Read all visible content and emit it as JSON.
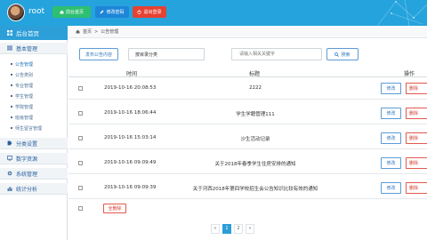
{
  "header": {
    "username": "root",
    "buttons": {
      "home": "前台首页",
      "change_password": "修改密码",
      "logout": "退出登录"
    }
  },
  "sidebar": {
    "home": "后台首页",
    "groups": [
      {
        "label": "基本管理"
      },
      {
        "label": "分类设置"
      },
      {
        "label": "数字资源"
      },
      {
        "label": "系统管理"
      },
      {
        "label": "统计分析"
      }
    ],
    "items": [
      {
        "label": "公告管理"
      },
      {
        "label": "公告类别"
      },
      {
        "label": "专业管理"
      },
      {
        "label": "学生管理"
      },
      {
        "label": "学院管理"
      },
      {
        "label": "班级管理"
      },
      {
        "label": "师生留言管理"
      }
    ]
  },
  "breadcrumb": {
    "home": "首页",
    "sep": ">",
    "current": "公告管理"
  },
  "toolbar": {
    "add_label": "发布公告内容",
    "select_value": "按目录分类",
    "search_placeholder": "请输入相关关键字",
    "search_label": "搜索"
  },
  "table": {
    "headers": {
      "time": "时间",
      "title": "标题",
      "actions": "操作"
    },
    "rows": [
      {
        "time": "2019-10-16 20:08:53",
        "title": "2222"
      },
      {
        "time": "2019-10-16 18:06:44",
        "title": "学生学籍管理111"
      },
      {
        "time": "2019-10-16 15:03:14",
        "title": "沙生活动记录"
      },
      {
        "time": "2019-10-16 09:09:49",
        "title": "关于2018年春季学生住房安排的通知"
      },
      {
        "time": "2019-10-16 09:09:39",
        "title": "关于河西2018年第四学校招生会公告知识比较有效的通知"
      }
    ],
    "edit_label": "修改",
    "delete_label": "删除"
  },
  "bulk_delete_label": "全删除",
  "pagination": {
    "pages": [
      "«",
      "1",
      "2",
      "»"
    ],
    "current": "1"
  },
  "colors": {
    "header_bg": "#25a3dd",
    "home_btn": "#2ebf71",
    "password_btn": "#1d86d8",
    "logout_btn": "#e54232",
    "accent": "#2c9ed8",
    "danger": "#d63b2f"
  }
}
